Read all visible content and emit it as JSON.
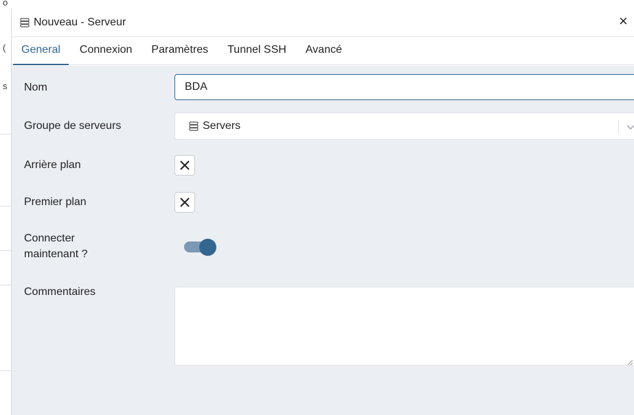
{
  "background_app": {
    "glyphs": [
      "o",
      "(",
      "s"
    ]
  },
  "dialog": {
    "title": "Nouveau - Serveur",
    "close_glyph": "×",
    "title_icon": "server-icon"
  },
  "tabs": [
    {
      "label": "General",
      "active": true
    },
    {
      "label": "Connexion",
      "active": false
    },
    {
      "label": "Paramètres",
      "active": false
    },
    {
      "label": "Tunnel SSH",
      "active": false
    },
    {
      "label": "Avancé",
      "active": false
    }
  ],
  "form": {
    "nom": {
      "label": "Nom",
      "value": "BDA"
    },
    "groupe": {
      "label": "Groupe de serveurs",
      "value": "Servers",
      "icon": "server-group-icon"
    },
    "arriere_plan": {
      "label": "Arrière plan",
      "checkbox_glyph": "✕"
    },
    "premier_plan": {
      "label": "Premier plan",
      "checkbox_glyph": "✕"
    },
    "connecter": {
      "label_line1": "Connecter",
      "label_line2": "maintenant ?",
      "enabled": true
    },
    "commentaires": {
      "label": "Commentaires",
      "value": ""
    }
  },
  "colors": {
    "accent": "#326690",
    "toggle_track": "#7b99b5",
    "panel_bg": "#ebeef3"
  }
}
